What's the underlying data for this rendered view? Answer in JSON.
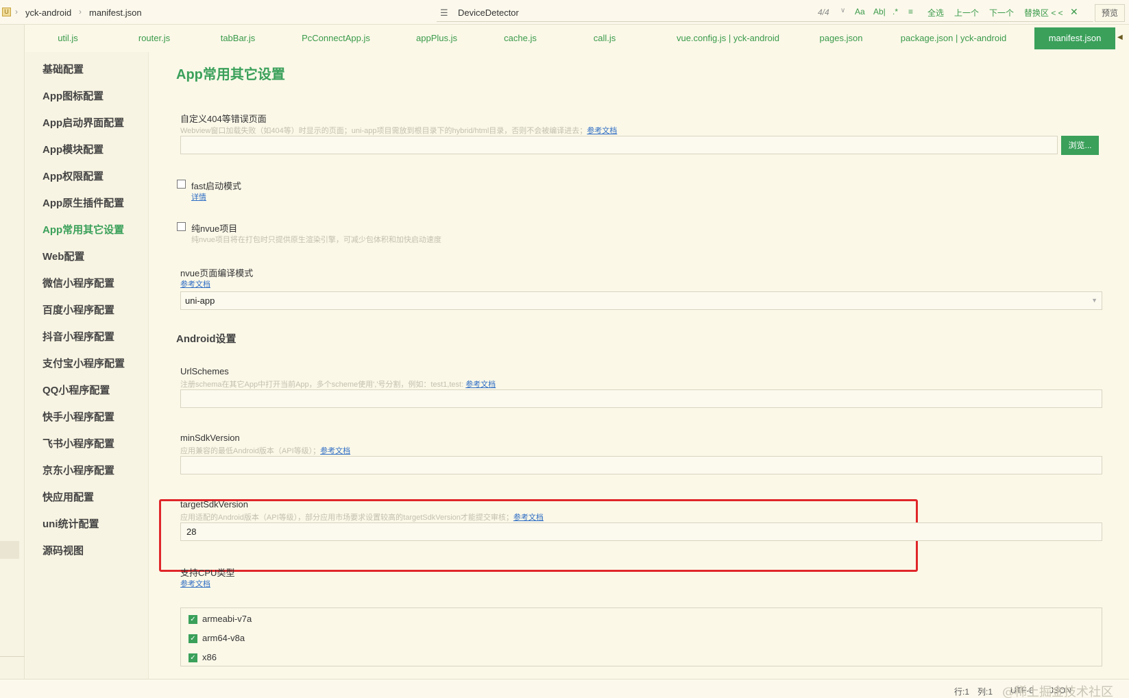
{
  "breadcrumb": {
    "project": "yck-android",
    "file": "manifest.json"
  },
  "find": {
    "query": "DeviceDetector",
    "count": "4/4",
    "tools": [
      "Aa",
      "Ab|",
      ".*",
      "全选",
      "上一个",
      "下一个",
      "替换区 < <"
    ],
    "preview": "预览"
  },
  "tabs": [
    "util.js",
    "router.js",
    "tabBar.js",
    "PcConnectApp.js",
    "appPlus.js",
    "cache.js",
    "call.js",
    "vue.config.js | yck-android",
    "pages.json",
    "package.json | yck-android",
    "manifest.json"
  ],
  "sidebar": {
    "items": [
      "基础配置",
      "App图标配置",
      "App启动界面配置",
      "App模块配置",
      "App权限配置",
      "App原生插件配置",
      "App常用其它设置",
      "Web配置",
      "微信小程序配置",
      "百度小程序配置",
      "抖音小程序配置",
      "支付宝小程序配置",
      "QQ小程序配置",
      "快手小程序配置",
      "飞书小程序配置",
      "京东小程序配置",
      "快应用配置",
      "uni统计配置",
      "源码视图"
    ],
    "active_index": 6
  },
  "main": {
    "title": "App常用其它设置",
    "error_page": {
      "label": "自定义404等错误页面",
      "hint": "Webview窗口加载失败（如404等）时显示的页面；uni-app项目需放到根目录下的hybrid/html目录，否则不会被编译进去；",
      "link": "参考文档",
      "value": "",
      "browse": "浏览..."
    },
    "fast_start": {
      "label": "fast启动模式",
      "link": "详情",
      "checked": false
    },
    "pure_nvue": {
      "label": "纯nvue项目",
      "hint": "纯nvue项目将在打包时只提供原生渲染引擎，可减少包体积和加快启动速度",
      "checked": false
    },
    "nvue_mode": {
      "label": "nvue页面编译模式",
      "link": "参考文档",
      "value": "uni-app"
    },
    "android_title": "Android设置",
    "url_schemes": {
      "label": "UrlSchemes",
      "hint": "注册schema在其它App中打开当前App，多个scheme使用','号分割，例如：test1,test:",
      "link": "参考文档",
      "value": ""
    },
    "min_sdk": {
      "label": "minSdkVersion",
      "hint": "应用兼容的最低Android版本（API等级）；",
      "link": "参考文档",
      "value": ""
    },
    "target_sdk": {
      "label": "targetSdkVersion",
      "hint": "应用适配的Android版本（API等级），部分应用市场要求设置较高的targetSdkVersion才能提交审核；",
      "link": "参考文档",
      "value": "28"
    },
    "cpu": {
      "label": "支持CPU类型",
      "link": "参考文档",
      "options": [
        "armeabi-v7a",
        "arm64-v8a",
        "x86"
      ],
      "checked": [
        true,
        true,
        true
      ]
    }
  },
  "statusbar": {
    "line": "行:1",
    "col": "列:1",
    "encoding": "UTF-8",
    "lang": "JSON",
    "watermark": "@稀土掘金技术社区"
  },
  "colors": {
    "accent": "#3aa05a",
    "highlight": "#e0262a",
    "background": "#fbf8e8"
  }
}
